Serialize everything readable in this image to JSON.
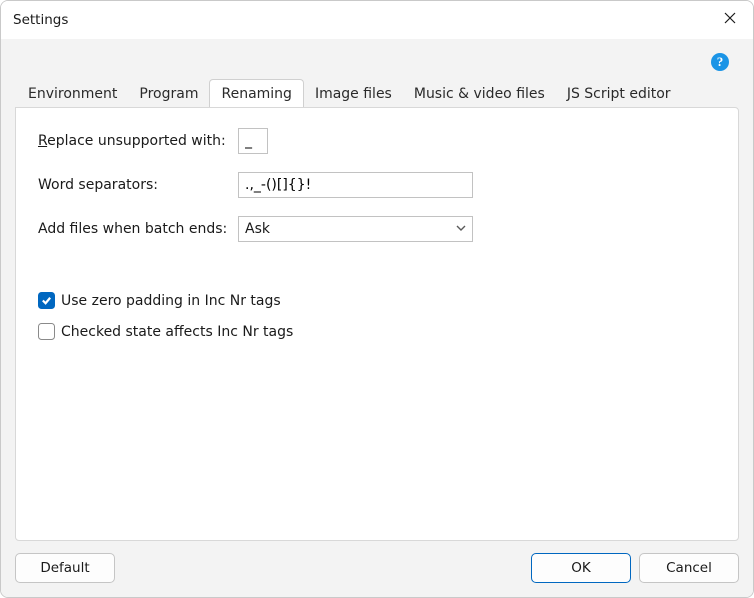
{
  "window": {
    "title": "Settings"
  },
  "tabs": {
    "items": [
      {
        "label": "Environment"
      },
      {
        "label": "Program"
      },
      {
        "label": "Renaming"
      },
      {
        "label": "Image files"
      },
      {
        "label": "Music & video files"
      },
      {
        "label": "JS Script editor"
      }
    ],
    "active_index": 2
  },
  "form": {
    "replace_label": "Replace unsupported with:",
    "replace_value": "_",
    "separators_label": "Word separators:",
    "separators_value": ".,_-()[]{}!",
    "batch_label": "Add files when batch ends:",
    "batch_value": "Ask",
    "zero_padding_label": "Use zero padding in Inc Nr tags",
    "zero_padding_checked": true,
    "checked_state_label": "Checked state affects Inc Nr tags",
    "checked_state_checked": false
  },
  "buttons": {
    "default": "Default",
    "ok": "OK",
    "cancel": "Cancel"
  }
}
